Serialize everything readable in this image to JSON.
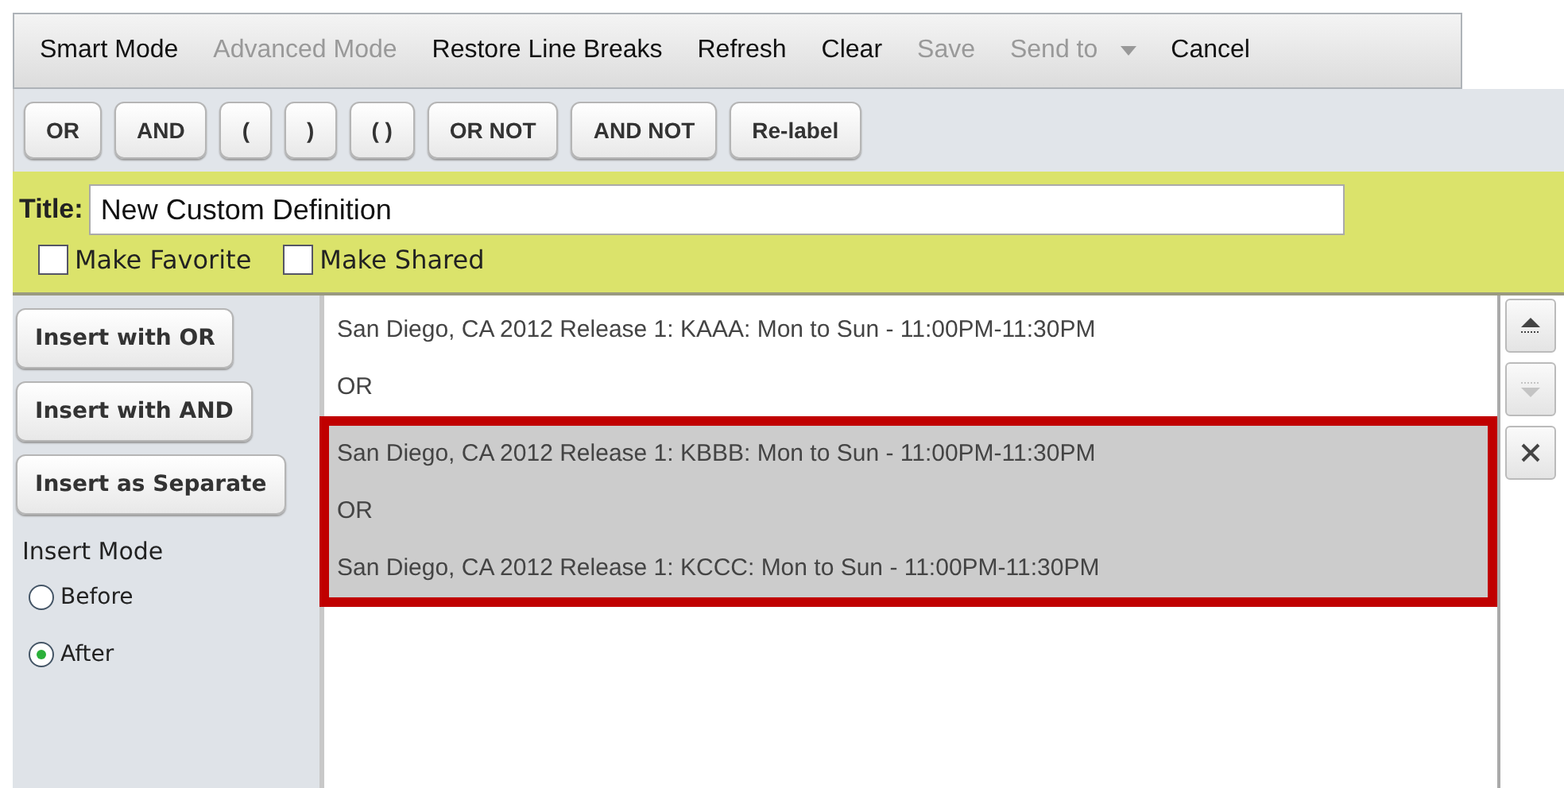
{
  "menu": [
    {
      "label": "Smart Mode",
      "disabled": false
    },
    {
      "label": "Advanced Mode",
      "disabled": true
    },
    {
      "label": "Restore Line Breaks",
      "disabled": false
    },
    {
      "label": "Refresh",
      "disabled": false
    },
    {
      "label": "Clear",
      "disabled": false
    },
    {
      "label": "Save",
      "disabled": true
    },
    {
      "label": "Send to",
      "disabled": true,
      "kind": "dropdown"
    },
    {
      "label": "Cancel",
      "disabled": false
    }
  ],
  "operators": [
    "OR",
    "AND",
    "(",
    ")",
    "( )",
    "OR NOT",
    "AND NOT",
    "Re-label"
  ],
  "title": {
    "label": "Title:",
    "value": "New Custom Definition"
  },
  "options": [
    {
      "label": "Make Favorite",
      "checked": false
    },
    {
      "label": "Make Shared",
      "checked": false
    }
  ],
  "insert_buttons": [
    "Insert with OR",
    "Insert with AND",
    "Insert as Separate"
  ],
  "insert_mode": {
    "label": "Insert Mode",
    "options": [
      {
        "label": "Before",
        "selected": false
      },
      {
        "label": "After",
        "selected": true
      }
    ]
  },
  "rows": [
    {
      "text": "San Diego, CA 2012 Release 1: KAAA: Mon to Sun - 11:00PM-11:30PM",
      "selected": false
    },
    {
      "text": "OR",
      "selected": false
    },
    {
      "text": "San Diego, CA 2012 Release 1: KBBB: Mon to Sun - 11:00PM-11:30PM",
      "selected": true
    },
    {
      "text": "OR",
      "selected": true
    },
    {
      "text": "San Diego, CA 2012 Release 1: KCCC: Mon to Sun - 11:00PM-11:30PM",
      "selected": true
    }
  ],
  "side_buttons": [
    {
      "kind": "up",
      "disabled": false
    },
    {
      "kind": "down",
      "disabled": true
    },
    {
      "kind": "remove",
      "disabled": false
    }
  ]
}
